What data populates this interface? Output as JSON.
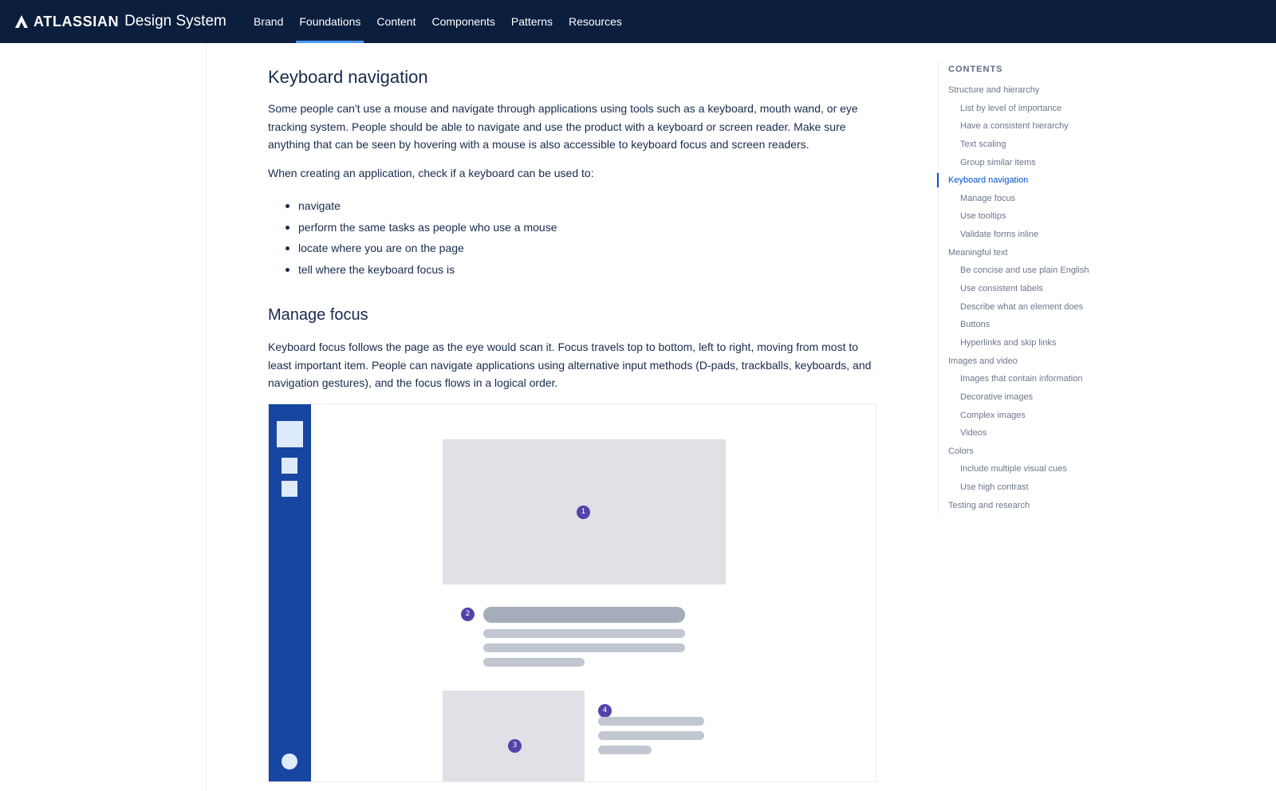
{
  "header": {
    "brand": "ATLASSIAN",
    "product": "Design System",
    "nav": [
      {
        "label": "Brand",
        "active": false
      },
      {
        "label": "Foundations",
        "active": true
      },
      {
        "label": "Content",
        "active": false
      },
      {
        "label": "Components",
        "active": false
      },
      {
        "label": "Patterns",
        "active": false
      },
      {
        "label": "Resources",
        "active": false
      }
    ]
  },
  "main": {
    "keyboard_heading": "Keyboard navigation",
    "keyboard_intro": "Some people can't use a mouse and navigate through applications using tools such as a keyboard, mouth wand, or eye tracking system. People should be able to navigate and use the product with a keyboard or screen reader. Make sure anything that can be seen by hovering with a mouse is also accessible to keyboard focus and screen readers.",
    "keyboard_check": "When creating an application, check if a keyboard can be used to:",
    "bullets": [
      "navigate",
      "perform the same tasks as people who use a mouse",
      "locate where you are on the page",
      "tell where the keyboard focus is"
    ],
    "focus_heading": "Manage focus",
    "focus_text": "Keyboard focus follows the page as the eye would scan it. Focus travels top to bottom, left to right, moving from most to least important item. People can navigate applications using alternative input methods (D-pads, trackballs, keyboards, and navigation gestures), and the focus flows in a logical order.",
    "illustration": {
      "badges": [
        "1",
        "2",
        "3",
        "4"
      ]
    }
  },
  "toc": {
    "heading": "CONTENTS",
    "items": [
      {
        "label": "Structure and hierarchy",
        "level": 1,
        "active": false
      },
      {
        "label": "List by level of importance",
        "level": 2,
        "active": false
      },
      {
        "label": "Have a consistent hierarchy",
        "level": 2,
        "active": false
      },
      {
        "label": "Text scaling",
        "level": 2,
        "active": false
      },
      {
        "label": "Group similar items",
        "level": 2,
        "active": false
      },
      {
        "label": "Keyboard navigation",
        "level": 1,
        "active": true
      },
      {
        "label": "Manage focus",
        "level": 2,
        "active": false
      },
      {
        "label": "Use tooltips",
        "level": 2,
        "active": false
      },
      {
        "label": "Validate forms inline",
        "level": 2,
        "active": false
      },
      {
        "label": "Meaningful text",
        "level": 1,
        "active": false
      },
      {
        "label": "Be concise and use plain English",
        "level": 2,
        "active": false
      },
      {
        "label": "Use consistent labels",
        "level": 2,
        "active": false
      },
      {
        "label": "Describe what an element does",
        "level": 2,
        "active": false
      },
      {
        "label": "Buttons",
        "level": 2,
        "active": false
      },
      {
        "label": "Hyperlinks and skip links",
        "level": 2,
        "active": false
      },
      {
        "label": "Images and video",
        "level": 1,
        "active": false
      },
      {
        "label": "Images that contain information",
        "level": 2,
        "active": false
      },
      {
        "label": "Decorative images",
        "level": 2,
        "active": false
      },
      {
        "label": "Complex images",
        "level": 2,
        "active": false
      },
      {
        "label": "Videos",
        "level": 2,
        "active": false
      },
      {
        "label": "Colors",
        "level": 1,
        "active": false
      },
      {
        "label": "Include multiple visual cues",
        "level": 2,
        "active": false
      },
      {
        "label": "Use high contrast",
        "level": 2,
        "active": false
      },
      {
        "label": "Testing and research",
        "level": 1,
        "active": false
      }
    ]
  },
  "colors": {
    "header_bg": "#0c1e3e",
    "nav_active_underline": "#4c9aff",
    "illustration_sidebar": "#1746a2",
    "badge": "#5243aa",
    "toc_active": "#0052cc"
  }
}
